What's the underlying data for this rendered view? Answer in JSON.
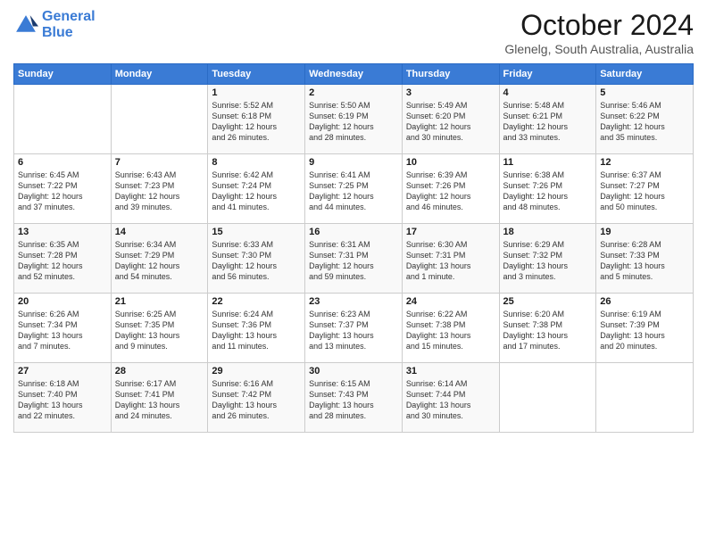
{
  "header": {
    "logo_general": "General",
    "logo_blue": "Blue",
    "month_title": "October 2024",
    "subtitle": "Glenelg, South Australia, Australia"
  },
  "days_of_week": [
    "Sunday",
    "Monday",
    "Tuesday",
    "Wednesday",
    "Thursday",
    "Friday",
    "Saturday"
  ],
  "weeks": [
    [
      {
        "num": "",
        "info": ""
      },
      {
        "num": "",
        "info": ""
      },
      {
        "num": "1",
        "info": "Sunrise: 5:52 AM\nSunset: 6:18 PM\nDaylight: 12 hours\nand 26 minutes."
      },
      {
        "num": "2",
        "info": "Sunrise: 5:50 AM\nSunset: 6:19 PM\nDaylight: 12 hours\nand 28 minutes."
      },
      {
        "num": "3",
        "info": "Sunrise: 5:49 AM\nSunset: 6:20 PM\nDaylight: 12 hours\nand 30 minutes."
      },
      {
        "num": "4",
        "info": "Sunrise: 5:48 AM\nSunset: 6:21 PM\nDaylight: 12 hours\nand 33 minutes."
      },
      {
        "num": "5",
        "info": "Sunrise: 5:46 AM\nSunset: 6:22 PM\nDaylight: 12 hours\nand 35 minutes."
      }
    ],
    [
      {
        "num": "6",
        "info": "Sunrise: 6:45 AM\nSunset: 7:22 PM\nDaylight: 12 hours\nand 37 minutes."
      },
      {
        "num": "7",
        "info": "Sunrise: 6:43 AM\nSunset: 7:23 PM\nDaylight: 12 hours\nand 39 minutes."
      },
      {
        "num": "8",
        "info": "Sunrise: 6:42 AM\nSunset: 7:24 PM\nDaylight: 12 hours\nand 41 minutes."
      },
      {
        "num": "9",
        "info": "Sunrise: 6:41 AM\nSunset: 7:25 PM\nDaylight: 12 hours\nand 44 minutes."
      },
      {
        "num": "10",
        "info": "Sunrise: 6:39 AM\nSunset: 7:26 PM\nDaylight: 12 hours\nand 46 minutes."
      },
      {
        "num": "11",
        "info": "Sunrise: 6:38 AM\nSunset: 7:26 PM\nDaylight: 12 hours\nand 48 minutes."
      },
      {
        "num": "12",
        "info": "Sunrise: 6:37 AM\nSunset: 7:27 PM\nDaylight: 12 hours\nand 50 minutes."
      }
    ],
    [
      {
        "num": "13",
        "info": "Sunrise: 6:35 AM\nSunset: 7:28 PM\nDaylight: 12 hours\nand 52 minutes."
      },
      {
        "num": "14",
        "info": "Sunrise: 6:34 AM\nSunset: 7:29 PM\nDaylight: 12 hours\nand 54 minutes."
      },
      {
        "num": "15",
        "info": "Sunrise: 6:33 AM\nSunset: 7:30 PM\nDaylight: 12 hours\nand 56 minutes."
      },
      {
        "num": "16",
        "info": "Sunrise: 6:31 AM\nSunset: 7:31 PM\nDaylight: 12 hours\nand 59 minutes."
      },
      {
        "num": "17",
        "info": "Sunrise: 6:30 AM\nSunset: 7:31 PM\nDaylight: 13 hours\nand 1 minute."
      },
      {
        "num": "18",
        "info": "Sunrise: 6:29 AM\nSunset: 7:32 PM\nDaylight: 13 hours\nand 3 minutes."
      },
      {
        "num": "19",
        "info": "Sunrise: 6:28 AM\nSunset: 7:33 PM\nDaylight: 13 hours\nand 5 minutes."
      }
    ],
    [
      {
        "num": "20",
        "info": "Sunrise: 6:26 AM\nSunset: 7:34 PM\nDaylight: 13 hours\nand 7 minutes."
      },
      {
        "num": "21",
        "info": "Sunrise: 6:25 AM\nSunset: 7:35 PM\nDaylight: 13 hours\nand 9 minutes."
      },
      {
        "num": "22",
        "info": "Sunrise: 6:24 AM\nSunset: 7:36 PM\nDaylight: 13 hours\nand 11 minutes."
      },
      {
        "num": "23",
        "info": "Sunrise: 6:23 AM\nSunset: 7:37 PM\nDaylight: 13 hours\nand 13 minutes."
      },
      {
        "num": "24",
        "info": "Sunrise: 6:22 AM\nSunset: 7:38 PM\nDaylight: 13 hours\nand 15 minutes."
      },
      {
        "num": "25",
        "info": "Sunrise: 6:20 AM\nSunset: 7:38 PM\nDaylight: 13 hours\nand 17 minutes."
      },
      {
        "num": "26",
        "info": "Sunrise: 6:19 AM\nSunset: 7:39 PM\nDaylight: 13 hours\nand 20 minutes."
      }
    ],
    [
      {
        "num": "27",
        "info": "Sunrise: 6:18 AM\nSunset: 7:40 PM\nDaylight: 13 hours\nand 22 minutes."
      },
      {
        "num": "28",
        "info": "Sunrise: 6:17 AM\nSunset: 7:41 PM\nDaylight: 13 hours\nand 24 minutes."
      },
      {
        "num": "29",
        "info": "Sunrise: 6:16 AM\nSunset: 7:42 PM\nDaylight: 13 hours\nand 26 minutes."
      },
      {
        "num": "30",
        "info": "Sunrise: 6:15 AM\nSunset: 7:43 PM\nDaylight: 13 hours\nand 28 minutes."
      },
      {
        "num": "31",
        "info": "Sunrise: 6:14 AM\nSunset: 7:44 PM\nDaylight: 13 hours\nand 30 minutes."
      },
      {
        "num": "",
        "info": ""
      },
      {
        "num": "",
        "info": ""
      }
    ]
  ]
}
